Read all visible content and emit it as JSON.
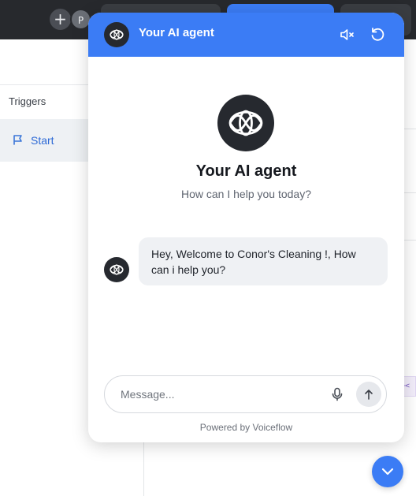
{
  "app": {
    "topbar": {
      "add_symbol": "+",
      "avatar_initial": "P"
    },
    "left_panel": {
      "section_label": "Triggers",
      "start_label": "Start"
    },
    "side_tool_glyph": "><"
  },
  "widget": {
    "header": {
      "title": "Your AI agent",
      "icons": [
        "agent-logo-icon",
        "mute-icon",
        "restart-icon"
      ]
    },
    "hero": {
      "title": "Your AI agent",
      "subtitle": "How can I help you today?"
    },
    "messages": [
      {
        "from": "agent",
        "text": "Hey, Welcome to Conor's Cleaning !, How can i help you?"
      }
    ],
    "composer": {
      "placeholder": "Message...",
      "value": ""
    },
    "footer": "Powered by Voiceflow"
  },
  "colors": {
    "accent": "#3b7cf5",
    "topbar": "#27292d",
    "agent_avatar": "#26292f",
    "bubble": "#eff1f4"
  }
}
